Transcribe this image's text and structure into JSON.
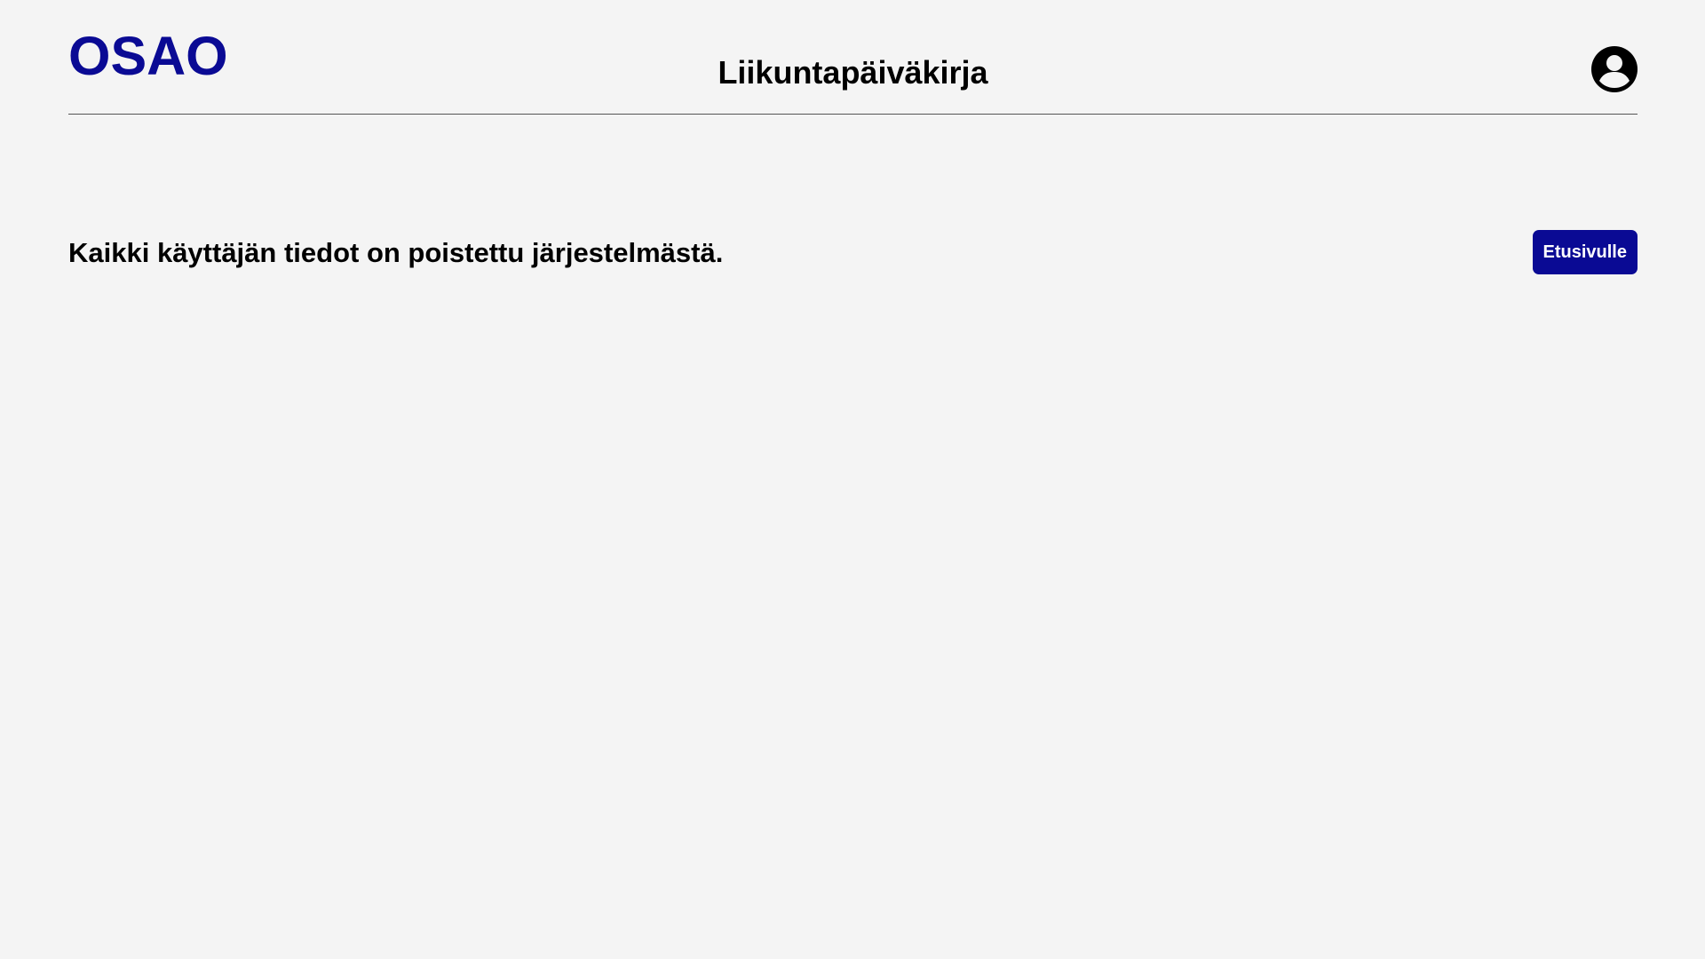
{
  "header": {
    "logo": "OSAO",
    "title": "Liikuntapäiväkirja",
    "user_icon": "account-circle-icon"
  },
  "main": {
    "message": "Kaikki käyttäjän tiedot on poistettu järjestelmästä.",
    "home_button_label": "Etusivulle"
  },
  "colors": {
    "brand": "#0a0a94",
    "background": "#f4f4f4",
    "text": "#000000",
    "button_text": "#ffffff"
  }
}
